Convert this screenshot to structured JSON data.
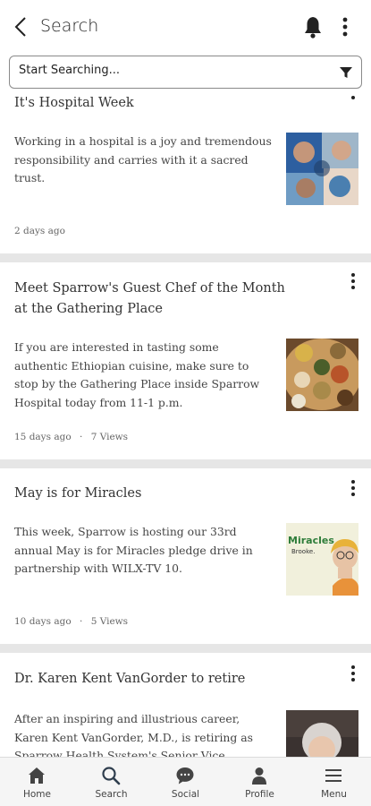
{
  "header": {
    "title": "Search"
  },
  "search": {
    "placeholder": "Start Searching..."
  },
  "articles": [
    {
      "title": "It's Hospital Week",
      "excerpt": "Working in a hospital is a joy and tremendous responsibility and carries with it a sacred trust.",
      "age": "2 days ago",
      "views": "",
      "thumb": "hospital-staff-collage"
    },
    {
      "title": "Meet Sparrow's Guest Chef of the Month at the Gathering Place",
      "excerpt": "If you are interested in tasting some authentic Ethiopian cuisine, make sure to stop by the Gathering Place inside Sparrow Hospital today from 11-1 p.m.",
      "age": "15 days ago",
      "views": "7 Views",
      "thumb": "ethiopian-food-platter"
    },
    {
      "title": "May is for Miracles",
      "excerpt": "This week, Sparrow is hosting our 33rd annual May is for Miracles pledge drive in partnership with WILX-TV 10.",
      "age": "10 days ago",
      "views": "5 Views",
      "thumb": "miracles-brooke-photo",
      "thumb_text_1": "Miracles",
      "thumb_text_2": "Brooke."
    },
    {
      "title": "Dr. Karen Kent VanGorder to retire",
      "excerpt": "After an inspiring and illustrious career, Karen Kent VanGorder, M.D., is retiring as Sparrow Health System's Senior Vice President and Chief Medical",
      "age": "",
      "views": "",
      "thumb": "portrait-photo"
    }
  ],
  "meta_separator": "·",
  "tabs": [
    {
      "label": "Home",
      "icon": "home-icon"
    },
    {
      "label": "Search",
      "icon": "search-icon"
    },
    {
      "label": "Social",
      "icon": "chat-bubble-icon"
    },
    {
      "label": "Profile",
      "icon": "person-icon"
    },
    {
      "label": "Menu",
      "icon": "hamburger-menu-icon"
    }
  ],
  "colors": {
    "accent": "#2f3e4e",
    "divider": "#e6e6e6",
    "tab_bg": "#f5f5f5"
  }
}
